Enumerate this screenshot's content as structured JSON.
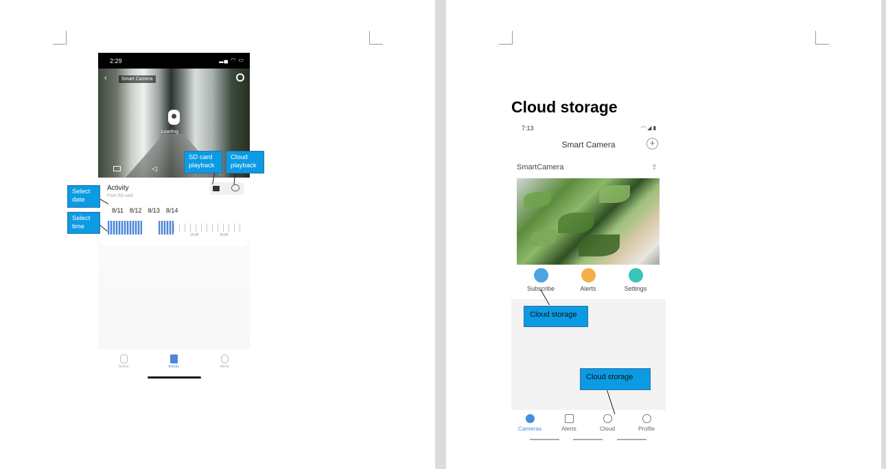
{
  "left_screenshot": {
    "status_time": "2:29",
    "camera_title": "Smart Camera",
    "loading_text": "Loading",
    "activity_title": "Activity",
    "activity_subtitle": "From SD card",
    "dates": [
      "8/11",
      "8/12",
      "8/13",
      "8/14"
    ],
    "timeline_labels": [
      "15:00",
      "16:00"
    ],
    "tabs": [
      "Device",
      "Activity",
      "Alerts"
    ],
    "active_tab": "Activity"
  },
  "left_callouts": {
    "sd_card": "SD    card playback",
    "cloud": "Cloud playback",
    "select_date": "Select date",
    "select_time": "Select time"
  },
  "right": {
    "heading": "Cloud storage",
    "status_time": "7:13",
    "app_title": "Smart Camera",
    "camera_name": "SmartCamera",
    "actions": [
      "Subscribe",
      "Alerts",
      "Settings"
    ],
    "tabs": [
      "Cameras",
      "Alerts",
      "Cloud",
      "Profile"
    ],
    "active_tab": "Cameras"
  },
  "right_callouts": {
    "subscribe": "Cloud storage",
    "cloud_tab": "Cloud storage"
  },
  "colors": {
    "callout": "#0b9be3",
    "accent_blue": "#3d8fe0",
    "subscribe_icon": "#4ea3e2",
    "alerts_icon": "#f6b04a",
    "settings_icon": "#37c6b8"
  }
}
